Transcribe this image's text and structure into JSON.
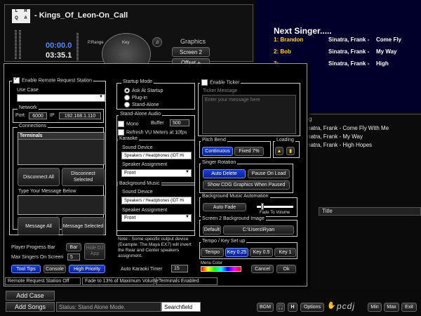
{
  "player": {
    "logo_letters": [
      "L",
      "R",
      "Q",
      "A"
    ],
    "song_title": "- Kings_Of_Leon-On_Call",
    "time_elapsed": "00:00.0",
    "time_remaining": "03:35.1",
    "key_label": "Key",
    "prange_label": "P.Range",
    "graphics_label": "Graphics",
    "screen2_label": "Screen 2",
    "offset_label": "Offset +"
  },
  "next_singer": {
    "title": "Next Singer.....",
    "entries": [
      {
        "num": "1:",
        "name": "Brandon",
        "artist": "Sinatra, Frank -",
        "song": "Come Fly"
      },
      {
        "num": "2:",
        "name": "Bob",
        "artist": "Sinatra, Frank -",
        "song": "My Way"
      },
      {
        "num": "3:",
        "name": "",
        "artist": "Sinatra, Frank -",
        "song": "High"
      }
    ]
  },
  "songlist": {
    "header_fragment": "ong",
    "rows": [
      "Sinatra, Frank -  Come Fly With Me",
      "Sinatra, Frank -  My Way",
      "Sinatra, Frank -  High Hopes"
    ],
    "title_column": "Title"
  },
  "dialog": {
    "enable_remote": "Enable Remote Request Station",
    "use_case": "Use Case",
    "network": "Network",
    "port_label": "Port",
    "port_value": "6000",
    "ip_label": "IP",
    "ip_value": "192.168.1.110",
    "connections": "Connections",
    "terminals": "Terminals",
    "disconnect_all": "Disconnect All",
    "disconnect_selected": "Disconnect Selected",
    "type_message": "Type Your Message Below",
    "message_all": "Message All",
    "message_selected": "Message Selected",
    "player_progress_bar": "Player Progress Bar",
    "bar_btn": "Bar",
    "hide_dj_app": "Hide DJ App",
    "max_singers": "Max Singers On Screen",
    "max_singers_value": "5",
    "tool_tips": "Tool Tips",
    "console": "Console",
    "high_priority": "High Priority",
    "startup_mode": "Startup Mode",
    "startup_options": [
      "Ask At Startup",
      "Plug-in",
      "Stand-Alone"
    ],
    "standalone_audio": "Stand-Alone Audio",
    "mono": "Mono",
    "buffer_label": "Buffer",
    "buffer_value": "500",
    "refresh_vu": "Refresh VU Meters at 10fps",
    "karaoke": "Karaoke",
    "sound_device": "Sound Device",
    "sound_device_value": "Speakers / Headphones (IDT Hi",
    "speaker_assignment": "Speaker Assignment",
    "speaker_value": "Front",
    "background_music": "Background Music",
    "note": "Note:- Some specific output device (Example: The Maya EX7) will invert the Rear and Center speakers assignment.",
    "autokaraoki_timer": "Auto Karaoki Timer",
    "timer_value": "15",
    "enable_ticker": "Enable Ticker",
    "ticker_message": "Ticker Message",
    "ticker_placeholder": "Enter your message here",
    "pitch_bend": "Pitch Bend",
    "continuous": "Continuous",
    "fixed": "Fixed 7%",
    "loading": "Loading",
    "singer_rotation": "Singer Rotation",
    "auto_delete": "Auto Delete",
    "pause_on_load": "Pause On Load",
    "show_cdg": "Show CDG Graphics When Paused",
    "bg_automation": "Background Music Automation",
    "auto_fade": "Auto Fade",
    "fade_to_volume": "Fade To Volume",
    "screen2_bg": "Screen 2 Background Image",
    "default_btn": "Default",
    "path_value": "C:\\Users\\Ryan",
    "tempo_key": "Tempo / Key Set up",
    "tempo": "Tempo",
    "key025": "Key 0.25",
    "key05": "Key 0.5",
    "key1": "Key 1",
    "menu_color": "Menu Color",
    "cancel": "Cancel",
    "ok": "Ok",
    "status_items": [
      "Remote Request Station Off",
      "Fade to 13% of Maximum Volume",
      "Terminals Enabled"
    ]
  },
  "bottom": {
    "add_case": "Add Case",
    "add_songs": "Add Songs",
    "status": "Status: Stand Alone Mode.",
    "searchfield": "Searchfield",
    "bgm": "BGM",
    "h": "H",
    "options": "Options",
    "pcdj": "pcdj",
    "min": "Min",
    "max": "Max",
    "exit": "Exit"
  },
  "colors": {
    "accent_blue": "#1a3fd0",
    "singer_yellow": "#ffd800",
    "next_bg": "#00002a"
  }
}
